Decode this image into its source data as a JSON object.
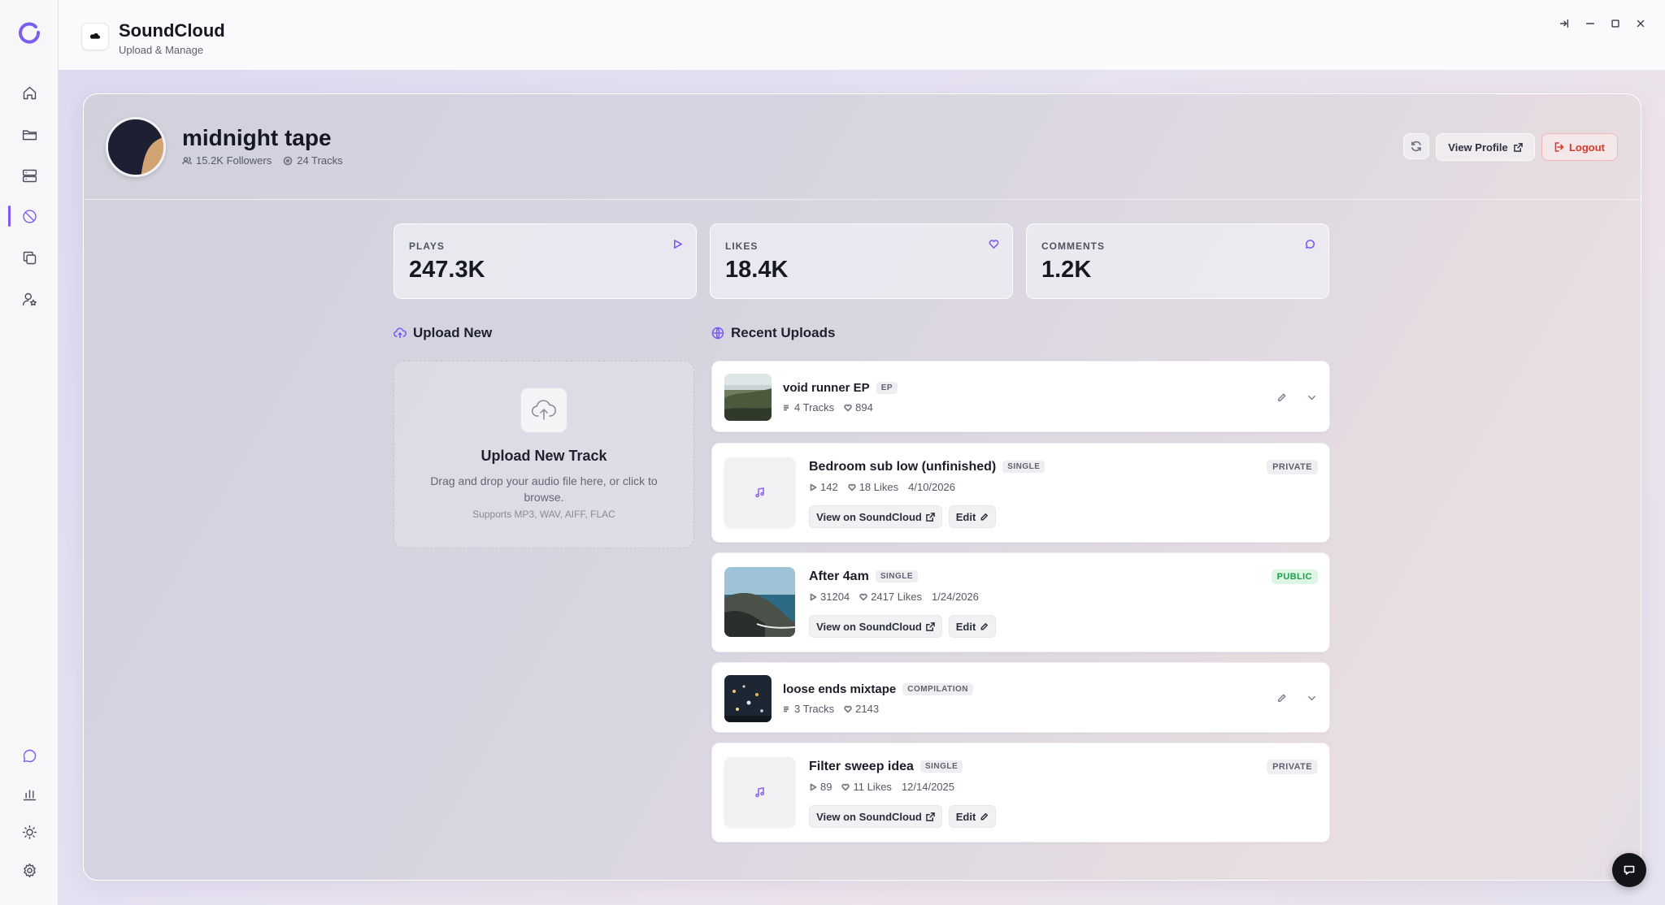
{
  "app": {
    "title": "SoundCloud",
    "subtitle": "Upload & Manage"
  },
  "rail": {
    "items": [
      "home-icon",
      "folder-icon",
      "server-icon",
      "soundcloud-blocked-icon",
      "copy-icon",
      "user-star-icon"
    ],
    "bottom": [
      "chat-icon",
      "chart-icon",
      "sun-icon",
      "settings-icon"
    ],
    "active": "soundcloud-blocked-icon",
    "accent": "#7b5cf0"
  },
  "profile": {
    "name": "midnight tape",
    "followers": "15.2K Followers",
    "tracks": "24 Tracks"
  },
  "actions": {
    "view_profile": "View Profile",
    "logout": "Logout"
  },
  "stats": [
    {
      "label": "PLAYS",
      "value": "247.3K",
      "icon": "play-icon"
    },
    {
      "label": "LIKES",
      "value": "18.4K",
      "icon": "heart-icon"
    },
    {
      "label": "COMMENTS",
      "value": "1.2K",
      "icon": "comment-icon"
    }
  ],
  "upload": {
    "heading": "Upload New",
    "title": "Upload New Track",
    "description": "Drag and drop your audio file here, or click to browse.",
    "formats": "Supports MP3, WAV, AIFF, FLAC"
  },
  "recent": {
    "heading": "Recent Uploads",
    "view_on": "View on SoundCloud",
    "edit": "Edit",
    "items": [
      {
        "title": "void runner EP",
        "type": "EP",
        "tracks": "4 Tracks",
        "likes": "894"
      },
      {
        "title": "Bedroom sub low (unfinished)",
        "type": "SINGLE",
        "plays": "142",
        "likes": "18 Likes",
        "date": "4/10/2026",
        "visibility": "PRIVATE"
      },
      {
        "title": "After 4am",
        "type": "SINGLE",
        "plays": "31204",
        "likes": "2417 Likes",
        "date": "1/24/2026",
        "visibility": "PUBLIC"
      },
      {
        "title": "loose ends mixtape",
        "type": "COMPILATION",
        "tracks": "3 Tracks",
        "likes": "2143"
      },
      {
        "title": "Filter sweep idea",
        "type": "SINGLE",
        "plays": "89",
        "likes": "11 Likes",
        "date": "12/14/2025",
        "visibility": "PRIVATE"
      }
    ]
  }
}
